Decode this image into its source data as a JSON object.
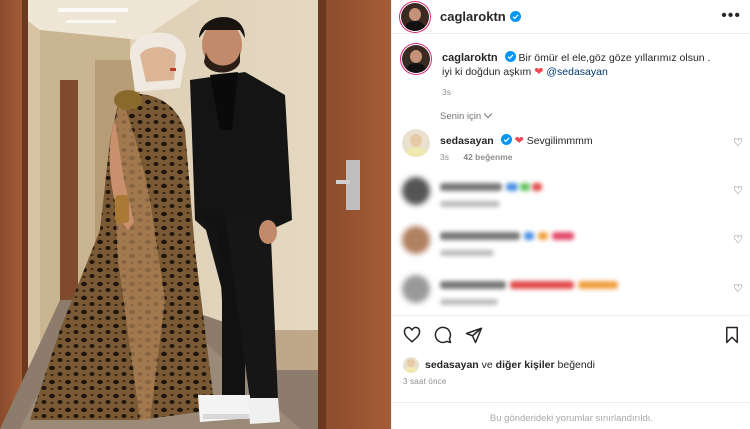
{
  "post": {
    "author": "caglaroktn",
    "more_icon": "more-horizontal-icon"
  },
  "caption": {
    "username": "caglaroktn",
    "line1": "Bir ömür el ele,göz göze yıllarımız olsun .",
    "line2": "iyi ki doğdun aşkım",
    "mention": "@sedasayan",
    "time": "3s"
  },
  "filter_label": "Senin için",
  "comments": [
    {
      "username": "sedasayan",
      "text": "Sevgilimmmm",
      "time": "3s",
      "likes": "42 beğenme"
    }
  ],
  "actions": {
    "icons": [
      "heart-icon",
      "comment-icon",
      "share-icon",
      "bookmark-icon"
    ]
  },
  "likes": {
    "user": "sedasayan",
    "connector": "ve",
    "others": "diğer kişiler",
    "suffix": "beğendi"
  },
  "post_time": "3 saat önce",
  "comments_limited": "Bu gönderideki yorumlar sınırlandırıldı.",
  "colors": {
    "verified": "#0095f6",
    "heart": "#ed4956",
    "mention": "#00376b",
    "story_ring": "#d62976"
  }
}
